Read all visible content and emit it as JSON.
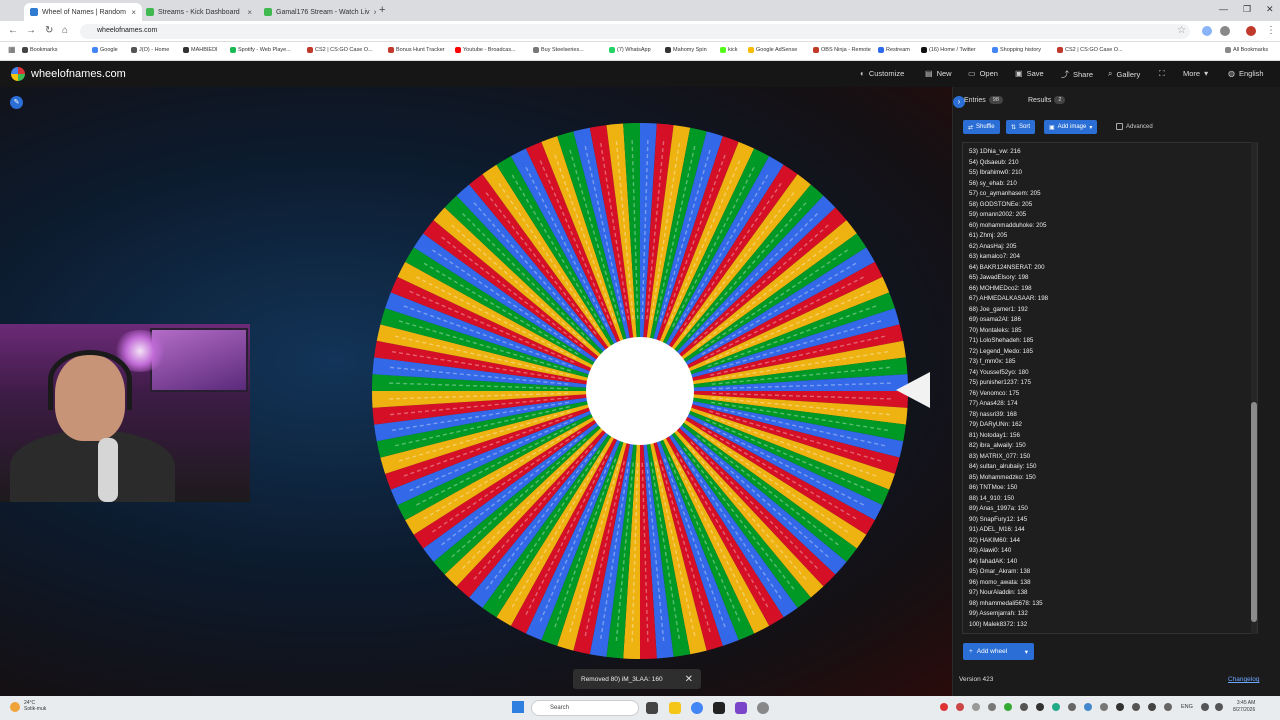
{
  "browser": {
    "tabs": [
      {
        "title": "Wheel of Names | Random",
        "color": "#2e7bcf",
        "active": true
      },
      {
        "title": "Streams - Kick Dashboard",
        "color": "#3fb950",
        "active": false
      },
      {
        "title": "Gamal176 Stream - Watch Liv",
        "color": "#3fb950",
        "active": false
      }
    ],
    "url": "wheelofnames.com",
    "bookmarks": [
      "Bookmarks",
      "Google",
      "J(O) - Home",
      "MAHBIEDI",
      "Spotify - Web Playe...",
      "CS2 | CS:GO Case O...",
      "Bonus Hunt Tracker",
      "Youtube - Broadcas...",
      "Buy Steelseries...",
      "(7) WhatsApp",
      "Mahomy Spin",
      "kick",
      "Google AdSense",
      "OBS Ninja - Remote",
      "Restream",
      "(16) Home / Twitter",
      "Shopping history",
      "CS2 | CS:GO Case O...",
      "All Bookmarks"
    ]
  },
  "app": {
    "site_name": "wheelofnames.com",
    "menu": [
      {
        "label": "Customize",
        "icon": "palette-icon"
      },
      {
        "label": "New",
        "icon": "new-file-icon"
      },
      {
        "label": "Open",
        "icon": "folder-icon"
      },
      {
        "label": "Save",
        "icon": "save-icon"
      },
      {
        "label": "Share",
        "icon": "share-icon"
      },
      {
        "label": "Gallery",
        "icon": "search-icon"
      },
      {
        "label": "",
        "icon": "fullscreen-icon"
      },
      {
        "label": "More",
        "icon": "chevron-down-icon"
      },
      {
        "label": "English",
        "icon": "globe-icon"
      }
    ]
  },
  "wheel": {
    "segment_colors": [
      "#3369e8",
      "#d50f25",
      "#eeb211",
      "#009925"
    ],
    "segment_count": 100
  },
  "toast": {
    "message": "Removed 80) iM_3LAA: 160"
  },
  "panel": {
    "entries_tab": "Entries",
    "entries_count": "98",
    "results_tab": "Results",
    "results_count": "2",
    "shuffle": "Shuffle",
    "sort": "Sort",
    "add_image": "Add image",
    "advanced": "Advanced",
    "entries": [
      "53) 1Dhia_vw: 216",
      "54) Qdsaeub: 210",
      "55) Ibrahimw0: 210",
      "56) sy_ehab: 210",
      "57) co_aymanhasem: 205",
      "58) GODSTONEe: 205",
      "59) omann2002: 205",
      "60) mohammadduhoke: 205",
      "61) Zhmj: 205",
      "62) AnasHaj: 205",
      "63) kamalco7: 204",
      "64) BAKR124NSERAT: 200",
      "65) JawadElsory: 198",
      "66) MOHMEDco2: 198",
      "67) AHMEDALKASAAR: 198",
      "68) Joe_gamer1: 192",
      "69) osama2Al: 186",
      "70) Montaleks: 185",
      "71) LoloShehadeh: 185",
      "72) Legend_Medo: 185",
      "73) f_mm0x: 185",
      "74) Youssef52yo: 180",
      "75) punisher1237: 175",
      "76) Venomco: 175",
      "77) Anas428: 174",
      "78) nassri39: 168",
      "79) DARyUNn: 162",
      "81) Notoday1: 156",
      "82) ibra_alwaily: 150",
      "83) MATRIX_077: 150",
      "84) sultan_alrubaiiy: 150",
      "85) Mohammedzko: 150",
      "86) TNTMoe: 150",
      "88) 14_910: 150",
      "89) Anas_1997a: 150",
      "90) SnapFury12: 145",
      "91) ADEL_M16: 144",
      "92) HAKIM60: 144",
      "93) Alawi0: 140",
      "94) fahadAK: 140",
      "95) Omar_Akram: 138",
      "96) momo_awata: 138",
      "97) NourAladdin: 138",
      "98) mhammedali5678: 135",
      "99) Assemjarrah: 132",
      "100) Malek8372: 132"
    ],
    "add_wheel": "Add wheel",
    "version": "Version 423",
    "changelog": "Changelog"
  },
  "taskbar": {
    "weather_temp": "24°C",
    "weather_desc": "Sotik-muk",
    "search_placeholder": "Search",
    "lang": "ENG",
    "time": "3:45 AM",
    "date": "8/27/2026"
  }
}
